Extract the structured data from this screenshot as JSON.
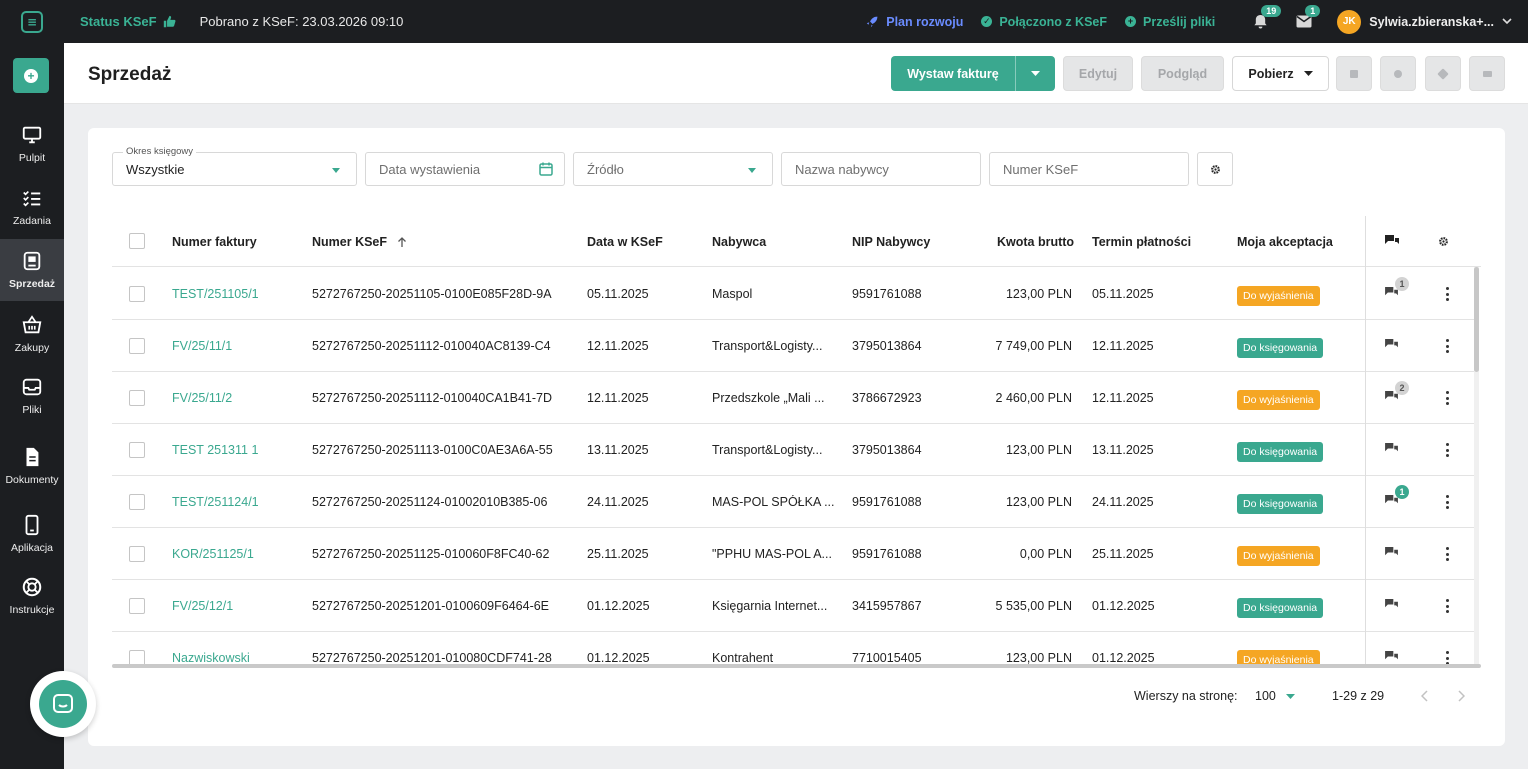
{
  "topbar": {
    "status_label": "Status KSeF",
    "fetched_text": "Pobrano z KSeF: 23.03.2026 09:10",
    "plan_label": "Plan rozwoju",
    "connected_label": "Połączono z KSeF",
    "upload_label": "Prześlij pliki",
    "notifications_count": "19",
    "messages_count": "1",
    "avatar_initials": "JK",
    "user_name": "Sylwia.zbieranska+..."
  },
  "sidebar": {
    "items": [
      {
        "label": "Pulpit",
        "icon": "monitor-icon"
      },
      {
        "label": "Zadania",
        "icon": "checklist-icon"
      },
      {
        "label": "Sprzedaż",
        "icon": "sales-icon"
      },
      {
        "label": "Zakupy",
        "icon": "basket-icon"
      },
      {
        "label": "Pliki",
        "icon": "inbox-icon"
      },
      {
        "label": "Dokumenty",
        "icon": "document-icon"
      },
      {
        "label": "Aplikacja",
        "icon": "phone-icon"
      },
      {
        "label": "Instrukcje",
        "icon": "lifebuoy-icon"
      }
    ]
  },
  "header": {
    "title": "Sprzedaż",
    "issue_invoice": "Wystaw fakturę",
    "edit": "Edytuj",
    "preview": "Podgląd",
    "download": "Pobierz"
  },
  "filters": {
    "period_label": "Okres księgowy",
    "period_value": "Wszystkie",
    "issue_date_placeholder": "Data wystawienia",
    "source_placeholder": "Źródło",
    "buyer_placeholder": "Nazwa nabywcy",
    "ksef_placeholder": "Numer KSeF"
  },
  "table": {
    "columns": [
      "Numer faktury",
      "Numer KSeF",
      "Data w KSeF",
      "Nabywca",
      "NIP Nabywcy",
      "Kwota brutto",
      "Termin płatności",
      "Moja akceptacja"
    ],
    "rows": [
      {
        "invoice": "TEST/251105/1",
        "ksef": "5272767250-20251105-0100E085F28D-9A",
        "date": "05.11.2025",
        "buyer": "Maspol",
        "nip": "9591761088",
        "amount": "123,00 PLN",
        "due": "05.11.2025",
        "status": "Do wyjaśnienia",
        "comments": "1"
      },
      {
        "invoice": "FV/25/11/1",
        "ksef": "5272767250-20251112-010040AC8139-C4",
        "date": "12.11.2025",
        "buyer": "Transport&Logisty...",
        "nip": "3795013864",
        "amount": "7 749,00 PLN",
        "due": "12.11.2025",
        "status": "Do księgowania",
        "comments": ""
      },
      {
        "invoice": "FV/25/11/2",
        "ksef": "5272767250-20251112-010040CA1B41-7D",
        "date": "12.11.2025",
        "buyer": "Przedszkole „Mali ...",
        "nip": "3786672923",
        "amount": "2 460,00 PLN",
        "due": "12.11.2025",
        "status": "Do wyjaśnienia",
        "comments": "2"
      },
      {
        "invoice": "TEST 251311 1",
        "ksef": "5272767250-20251113-0100C0AE3A6A-55",
        "date": "13.11.2025",
        "buyer": "Transport&Logisty...",
        "nip": "3795013864",
        "amount": "123,00 PLN",
        "due": "13.11.2025",
        "status": "Do księgowania",
        "comments": ""
      },
      {
        "invoice": "TEST/251124/1",
        "ksef": "5272767250-20251124-01002010B385-06",
        "date": "24.11.2025",
        "buyer": "MAS-POL SPÓŁKA ...",
        "nip": "9591761088",
        "amount": "123,00 PLN",
        "due": "24.11.2025",
        "status": "Do księgowania",
        "comments": "1"
      },
      {
        "invoice": "KOR/251125/1",
        "ksef": "5272767250-20251125-010060F8FC40-62",
        "date": "25.11.2025",
        "buyer": "\"PPHU MAS-POL A...",
        "nip": "9591761088",
        "amount": "0,00 PLN",
        "due": "25.11.2025",
        "status": "Do wyjaśnienia",
        "comments": ""
      },
      {
        "invoice": "FV/25/12/1",
        "ksef": "5272767250-20251201-0100609F6464-6E",
        "date": "01.12.2025",
        "buyer": "Księgarnia Internet...",
        "nip": "3415957867",
        "amount": "5 535,00 PLN",
        "due": "01.12.2025",
        "status": "Do księgowania",
        "comments": ""
      },
      {
        "invoice": "Nazwiskowski",
        "ksef": "5272767250-20251201-010080CDF741-28",
        "date": "01.12.2025",
        "buyer": "Kontrahent",
        "nip": "7710015405",
        "amount": "123,00 PLN",
        "due": "01.12.2025",
        "status": "Do wyjaśnienia",
        "comments": ""
      }
    ]
  },
  "footer": {
    "rows_per_page_label": "Wierszy na stronę:",
    "rows_per_page_value": "100",
    "range": "1-29 z 29"
  },
  "colors": {
    "accent": "#3aa88f",
    "status_warning": "#f5a623",
    "status_ok": "#3aa88f",
    "topbar_bg": "#1c1e21",
    "link_blue": "#6a8cff"
  }
}
